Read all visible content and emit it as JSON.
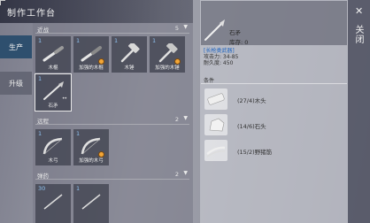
{
  "header": {
    "title": "制作工作台"
  },
  "tabs": [
    {
      "label": "生产",
      "active": true
    },
    {
      "label": "升级",
      "active": false
    }
  ],
  "categories": [
    {
      "name": "近战",
      "count": "5",
      "items": [
        {
          "qty": "1",
          "label": "木棍",
          "icon": "stick-icon"
        },
        {
          "qty": "1",
          "label": "加强的木棍",
          "icon": "stick-icon",
          "upgraded": true
        },
        {
          "qty": "1",
          "label": "木锤",
          "icon": "hammer-icon"
        },
        {
          "qty": "1",
          "label": "加强的木锤",
          "icon": "hammer-icon",
          "upgraded": true
        },
        {
          "qty": "1",
          "label": "石矛",
          "icon": "spear-icon",
          "selected": true
        }
      ]
    },
    {
      "name": "远程",
      "count": "2",
      "items": [
        {
          "qty": "1",
          "label": "木弓",
          "icon": "bow-icon"
        },
        {
          "qty": "1",
          "label": "加强的木弓",
          "icon": "bow-icon",
          "upgraded": true
        }
      ]
    },
    {
      "name": "弹药",
      "count": "2",
      "items": [
        {
          "qty": "30",
          "label": "",
          "icon": "arrow-icon"
        },
        {
          "qty": "1",
          "label": "",
          "icon": "arrow-icon"
        }
      ]
    }
  ],
  "detail": {
    "name": "石矛",
    "stock": "库存: 0",
    "type": "[长枪类武器]",
    "attack": "攻击力: 34-85",
    "durability": "耐久度: 450",
    "materials_header": "条件",
    "materials": [
      {
        "text": "(27/4)木头",
        "icon": "wood-icon"
      },
      {
        "text": "(14/6)石头",
        "icon": "stone-icon"
      },
      {
        "text": "(15/2)野猪筋",
        "icon": "sinew-icon"
      }
    ]
  },
  "close": {
    "x": "✕",
    "label": "关闭"
  },
  "colors": {
    "accent_tab": "#2e4f6e",
    "qty_blue": "#8fc3f2",
    "weapon_type_blue": "#2266c0",
    "upgrade_badge": "#f3a637"
  }
}
